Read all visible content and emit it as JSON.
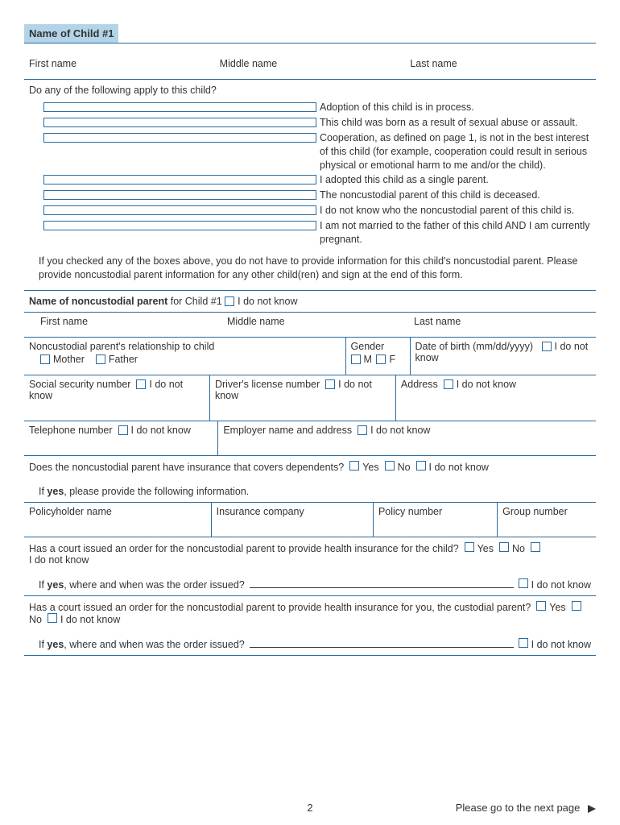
{
  "sectionTitle": "Name of Child #1",
  "nameLabels": {
    "first": "First name",
    "middle": "Middle name",
    "last": "Last name"
  },
  "question1": "Do any of the following apply to this child?",
  "checks": [
    "Adoption of this child is in process.",
    "This child was born as a result of sexual abuse or assault.",
    "Cooperation, as defined on page 1, is not in the best interest of this child (for example, cooperation could result in serious physical or emotional harm to me and/or the child).",
    "I adopted this child as a single parent.",
    "The noncustodial parent of this child is deceased.",
    "I do not know who the noncustodial parent of this child is.",
    "I am not married to the father of this child AND I am currently pregnant."
  ],
  "infoPara": "If you checked any of the boxes above, you do not have to provide information for this child's noncustodial parent. Please provide noncustodial parent information for any other child(ren) and sign at the end of this form.",
  "ncp": {
    "lineBold": "Name of noncustodial parent",
    "lineRest": " for Child #1 ",
    "dontKnow": "I do not know",
    "relLabel": "Noncustodial parent's relationship to child",
    "mother": "Mother",
    "father": "Father",
    "genderLabel": "Gender",
    "m": "M",
    "f": "F",
    "dobLabel": "Date of birth  (mm/dd/yyyy)",
    "ssn": "Social security number",
    "dl": "Driver's license number",
    "addr": "Address",
    "tel": "Telephone number",
    "emp": "Employer name and address"
  },
  "ins": {
    "q": "Does the noncustodial parent have insurance that covers dependents?",
    "yes": "Yes",
    "no": "No",
    "ifyes": "If ",
    "ifyesBold": "yes",
    "ifyesRest": ", please provide the following information.",
    "policyholder": "Policyholder name",
    "company": "Insurance company",
    "policynum": "Policy number",
    "groupnum": "Group number"
  },
  "court1": "Has a court issued an order for the noncustodial parent to provide health insurance for the child?",
  "court2": "Has a court issued an order for the noncustodial parent to provide health insurance for you, the custodial parent?",
  "whereWhen": "If ",
  "whereWhenBold": "yes",
  "whereWhenRest": ", where and when was the order issued?",
  "footer": {
    "page": "2",
    "next": "Please go to the next page"
  },
  "dontKnow": "I do not know"
}
